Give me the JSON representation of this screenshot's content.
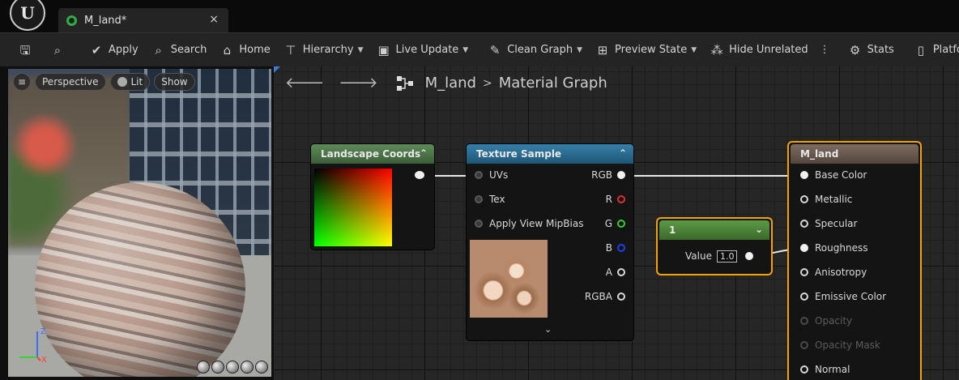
{
  "titlebar": {
    "logo_glyph": "U",
    "tab": {
      "label": "M_land*",
      "close": "×"
    }
  },
  "toolbar": {
    "items": [
      {
        "label": "",
        "icon": "save-icon",
        "glyph": "🖫"
      },
      {
        "label": "",
        "icon": "browse-icon",
        "glyph": "⌕"
      },
      {
        "label": "Apply",
        "icon": "apply-icon",
        "glyph": "✔"
      },
      {
        "label": "Search",
        "icon": "search-icon",
        "glyph": "⌕"
      },
      {
        "label": "Home",
        "icon": "home-icon",
        "glyph": "⌂"
      },
      {
        "label": "Hierarchy",
        "icon": "hierarchy-icon",
        "glyph": "⊤"
      },
      {
        "label": "Live Update",
        "icon": "live-update-icon",
        "glyph": "▣"
      },
      {
        "label": "Clean Graph",
        "icon": "clean-graph-icon",
        "glyph": "✎"
      },
      {
        "label": "Preview State",
        "icon": "preview-state-icon",
        "glyph": "⊞"
      },
      {
        "label": "Hide Unrelated",
        "icon": "hide-unrelated-icon",
        "glyph": "⁂"
      },
      {
        "label": "Stats",
        "icon": "stats-icon",
        "glyph": "⚙"
      },
      {
        "label": "Platfo",
        "icon": "platform-icon",
        "glyph": "▯"
      }
    ]
  },
  "viewport": {
    "buttons": {
      "menu": "≡",
      "perspective": "Perspective",
      "lit": "Lit",
      "show": "Show"
    },
    "axis": {
      "z": "Z",
      "x": "X"
    }
  },
  "graph": {
    "breadcrumb": {
      "asset": "M_land",
      "sep": ">",
      "view": "Material Graph"
    },
    "nav": {
      "back": "🡐",
      "forward": "🡒"
    },
    "nodes": {
      "landscape_coords": {
        "title": "Landscape Coords",
        "color": "#4d7a4a"
      },
      "texture_sample": {
        "title": "Texture Sample",
        "color": "#2b6f96",
        "inputs": [
          "UVs",
          "Tex",
          "Apply View MipBias"
        ],
        "outputs": [
          "RGB",
          "R",
          "G",
          "B",
          "A",
          "RGBA"
        ]
      },
      "constant": {
        "title": "1",
        "value_label": "Value",
        "value": "1.0",
        "color": "#4a8a36"
      },
      "material": {
        "title": "M_land",
        "color": "#6a5a50",
        "inputs": [
          "Base Color",
          "Metallic",
          "Specular",
          "Roughness",
          "Anisotropy",
          "Emissive Color",
          "Opacity",
          "Opacity Mask",
          "Normal"
        ]
      }
    }
  },
  "colors": {
    "selection": "#f5a300",
    "accent": "#3a7bd5"
  }
}
